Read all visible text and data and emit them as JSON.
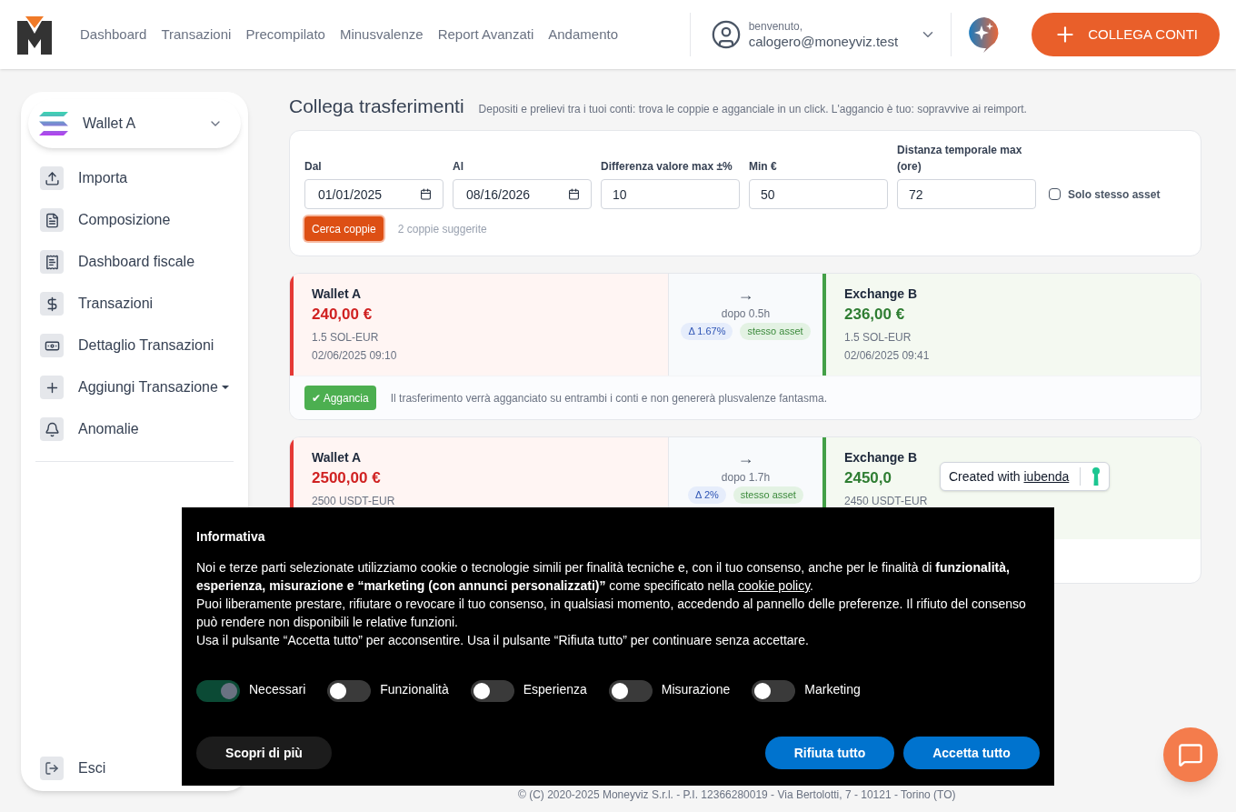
{
  "nav": {
    "links": [
      "Dashboard",
      "Transazioni",
      "Precompilato",
      "Minusvalenze",
      "Report Avanzati",
      "Andamento"
    ],
    "user": {
      "greeting": "benvenuto,",
      "email": "calogero@moneyviz.test"
    },
    "cta": "COLLEGA CONTI"
  },
  "sidebar": {
    "wallet": "Wallet A",
    "items": [
      {
        "label": "Importa",
        "dropdown": false
      },
      {
        "label": "Composizione",
        "dropdown": false
      },
      {
        "label": "Dashboard fiscale",
        "dropdown": false
      },
      {
        "label": "Transazioni",
        "dropdown": false
      },
      {
        "label": "Dettaglio Transazioni",
        "dropdown": false
      },
      {
        "label": "Aggiungi Transazione",
        "dropdown": true
      },
      {
        "label": "Anomalie",
        "dropdown": false
      }
    ],
    "logout": "Esci"
  },
  "page": {
    "title": "Collega trasferimenti",
    "subtitle": "Depositi e prelievi tra i tuoi conti: trova le coppie e agganciale in un click. L'aggancio è tuo: sopravvive ai reimport.",
    "filters": [
      {
        "label": "Dal",
        "value": "01/01/2025",
        "kind": "date"
      },
      {
        "label": "Al",
        "value": "08/16/2026",
        "kind": "date"
      },
      {
        "label": "Differenza valore max ±%",
        "value": "10",
        "kind": "number"
      },
      {
        "label": "Min €",
        "value": "50",
        "kind": "number"
      },
      {
        "label": "Distanza temporale max (ore)",
        "value": "72",
        "kind": "number"
      }
    ],
    "same_asset": {
      "label": "Solo stesso asset",
      "checked": false
    },
    "search_button": "Cerca coppie",
    "result": "2 coppie suggerite"
  },
  "pairs": [
    {
      "from": {
        "name": "Wallet A",
        "amount": "240,00 €",
        "qty": "1.5 SOL-EUR",
        "date": "02/06/2025 09:10"
      },
      "arrow": "→",
      "gap": "dopo 0.5h",
      "delta": "Δ 1.67%",
      "badge": "stesso asset",
      "to": {
        "name": "Exchange B",
        "amount": "236,00 €",
        "qty": "1.5 SOL-EUR",
        "date": "02/06/2025 09:41"
      },
      "action": "✔ Aggancia",
      "note": "Il trasferimento verrà agganciato su entrambi i conti e non genererà plusvalenze fantasma."
    },
    {
      "from": {
        "name": "Wallet A",
        "amount": "2500,00 €",
        "qty": "2500 USDT-EUR"
      },
      "arrow": "→",
      "gap": "dopo 1.7h",
      "delta": "Δ 2%",
      "badge": "stesso asset",
      "to": {
        "name": "Exchange B",
        "amount": "2450,0",
        "qty": "2450 USDT-EUR"
      }
    }
  ],
  "iubenda": {
    "text": "Created with",
    "link": "iubenda"
  },
  "cookie": {
    "title": "Informativa",
    "intro": "Noi e terze parti selezionate utilizziamo cookie o tecnologie simili per finalità tecniche e, con il tuo consenso, anche per le finalità di **funzionalità, esperienza, misurazione e “marketing (con annunci personalizzati)”** come specificato nella",
    "link": "cookie policy",
    "after": ".",
    "paragraphs": [
      "Puoi liberamente prestare, rifiutare o revocare il tuo consenso, in qualsiasi momento, accedendo al pannello delle preferenze. Il rifiuto del consenso può rendere non disponibili le relative funzioni.",
      "Usa il pulsante “Accetta tutto” per acconsentire. Usa il pulsante “Rifiuta tutto” per continuare senza accettare."
    ],
    "toggles": [
      {
        "label": "Necessari",
        "on": true
      },
      {
        "label": "Funzionalità",
        "on": false
      },
      {
        "label": "Esperienza",
        "on": false
      },
      {
        "label": "Misurazione",
        "on": false
      },
      {
        "label": "Marketing",
        "on": false
      }
    ],
    "more": "Scopri di più",
    "reject": "Rifiuta tutto",
    "accept": "Accetta tutto"
  },
  "footer": "© (C) 2020-2025 Moneyviz S.r.l. - P.I. 12366280019 - Via Bertolotti, 7 - 10121 - Torino (TO)"
}
